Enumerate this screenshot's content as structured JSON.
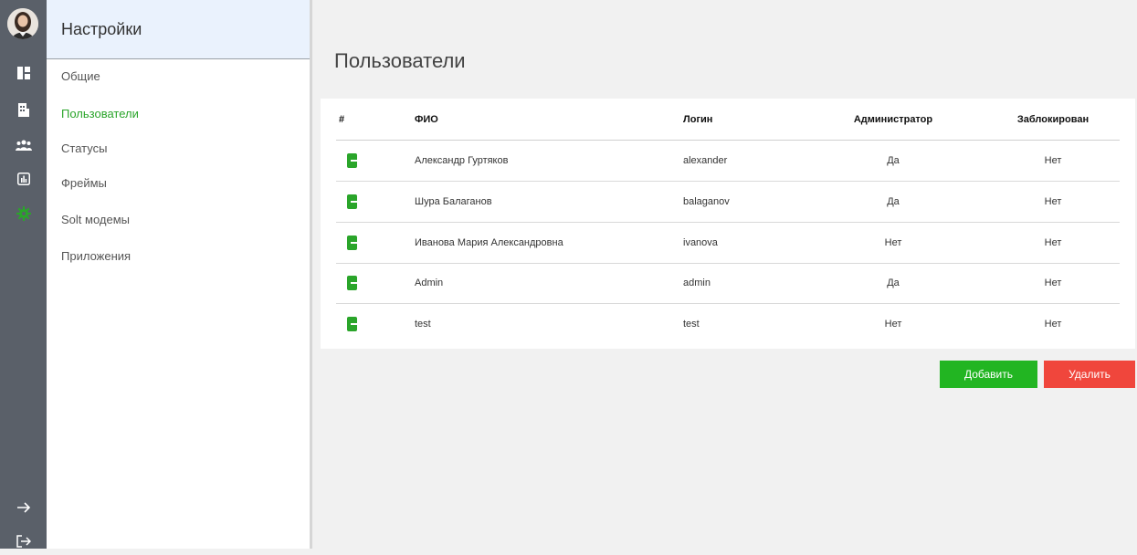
{
  "sidebar": {
    "title": "Настройки",
    "items": [
      {
        "label": "Общие",
        "active": false
      },
      {
        "label": "Пользователи",
        "active": true
      },
      {
        "label": "Статусы",
        "active": false
      },
      {
        "label": "Фреймы",
        "active": false
      },
      {
        "label": "Solt модемы",
        "active": false
      },
      {
        "label": "Приложения",
        "active": false
      }
    ]
  },
  "rail_icons": [
    "avatar",
    "dashboard-icon",
    "building-icon",
    "users-icon",
    "chart-icon",
    "gear-icon",
    "arrow-right-icon",
    "logout-icon"
  ],
  "main": {
    "title": "Пользователи",
    "table": {
      "headers": {
        "num": "#",
        "fio": "ФИО",
        "login": "Логин",
        "admin": "Администратор",
        "blocked": "Заблокирован"
      },
      "rows": [
        {
          "fio": "Александр Гуртяков",
          "login": "alexander",
          "admin": "Да",
          "blocked": "Нет"
        },
        {
          "fio": "Шура Балаганов",
          "login": "balaganov",
          "admin": "Да",
          "blocked": "Нет"
        },
        {
          "fio": "Иванова Мария Александровна",
          "login": "ivanova",
          "admin": "Нет",
          "blocked": "Нет"
        },
        {
          "fio": "Admin",
          "login": "admin",
          "admin": "Да",
          "blocked": "Нет"
        },
        {
          "fio": "test",
          "login": "test",
          "admin": "Нет",
          "blocked": "Нет"
        }
      ]
    },
    "actions": {
      "add": "Добавить",
      "delete": "Удалить"
    }
  },
  "colors": {
    "accent_green": "#22b522",
    "danger_red": "#f0463c",
    "rail_bg": "#5a6069"
  }
}
